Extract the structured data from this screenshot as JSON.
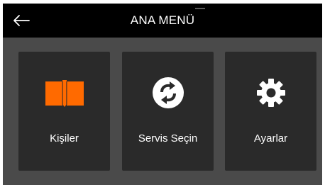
{
  "header": {
    "title": "ANA MENÜ",
    "back_icon": "back-arrow-icon"
  },
  "tiles": [
    {
      "label": "Kişiler",
      "icon": "book-icon",
      "icon_color": "#ff6a00"
    },
    {
      "label": "Servis Seçin",
      "icon": "service-switch-icon",
      "icon_color": "#ffffff"
    },
    {
      "label": "Ayarlar",
      "icon": "gear-icon",
      "icon_color": "#ffffff"
    }
  ],
  "colors": {
    "header_bg": "#000000",
    "screen_bg": "#4a4a4a",
    "tile_bg": "#2a2a2a",
    "accent": "#ff6a00",
    "text": "#ffffff"
  }
}
